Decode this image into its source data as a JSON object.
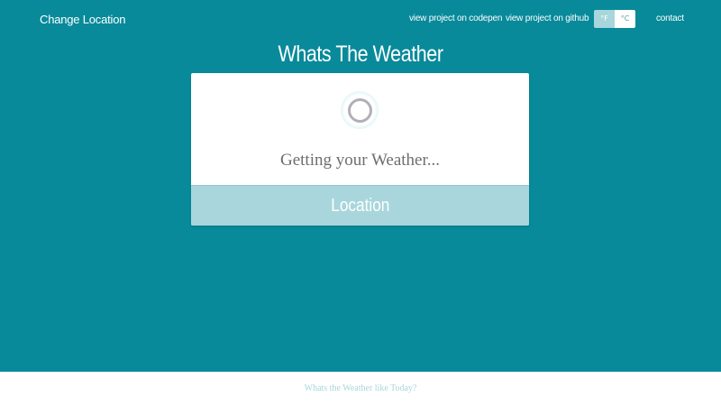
{
  "navbar": {
    "brand": "Change Location",
    "links": {
      "codepen": "view project on codepen",
      "github": "view project on github",
      "contact": "contact"
    },
    "units": {
      "fahrenheit": "°F",
      "celsius": "°C",
      "selected": "fahrenheit"
    }
  },
  "page": {
    "title": "Whats The Weather"
  },
  "card": {
    "loading_text": "Getting your Weather...",
    "location_label": "Location"
  },
  "footer": {
    "text": "Whats the Weather like Today?"
  },
  "colors": {
    "background": "#088a9a",
    "accent_light": "#a8d6dc",
    "card": "#ffffff",
    "spinner": "#b3aeb8",
    "loading_text": "#6e6e70"
  }
}
